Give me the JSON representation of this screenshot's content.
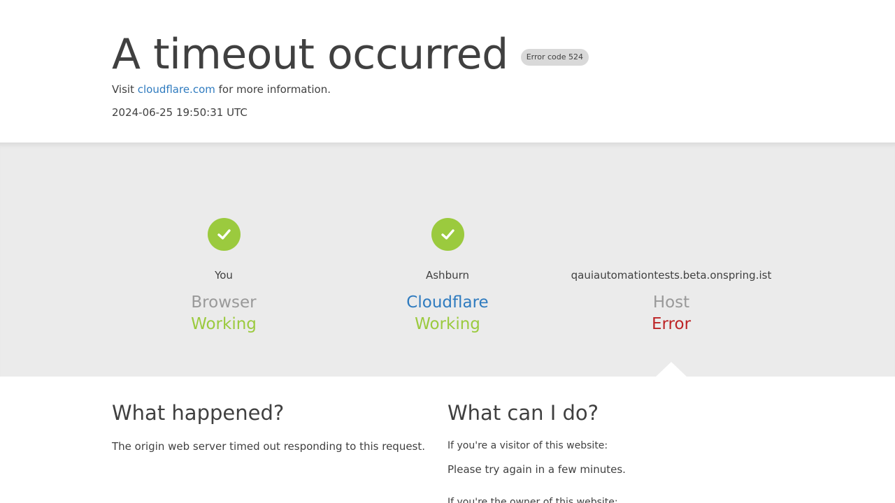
{
  "header": {
    "title": "A timeout occurred",
    "error_badge": "Error code 524",
    "visit_prefix": "Visit ",
    "visit_link": "cloudflare.com",
    "visit_suffix": " for more information.",
    "timestamp": "2024-06-25 19:50:31 UTC"
  },
  "status": {
    "columns": [
      {
        "location": "You",
        "entity": "Browser",
        "state": "Working",
        "icon": "check-icon"
      },
      {
        "location": "Ashburn",
        "entity": "Cloudflare",
        "state": "Working",
        "icon": "check-icon"
      },
      {
        "location": "qauiautomationtests.beta.onspring.ist",
        "entity": "Host",
        "state": "Error",
        "icon": ""
      }
    ]
  },
  "info": {
    "what_happened": {
      "heading": "What happened?",
      "text": "The origin web server timed out responding to this request."
    },
    "what_can_i_do": {
      "heading": "What can I do?",
      "visitor_label": "If you're a visitor of this website:",
      "visitor_text": "Please try again in a few minutes.",
      "owner_label": "If you're the owner of this website:"
    }
  },
  "colors": {
    "working": "#9bca3e",
    "error": "#bd2426",
    "link": "#2f7bbf",
    "band": "#ebebeb"
  }
}
